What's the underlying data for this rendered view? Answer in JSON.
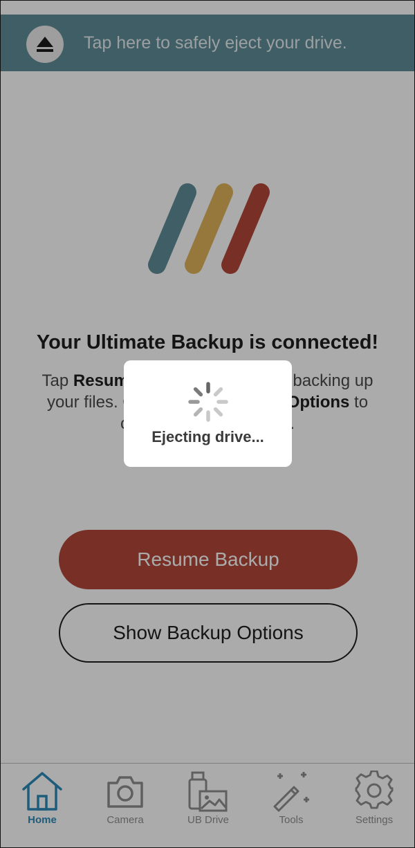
{
  "eject_banner": {
    "text": "Tap here to safely eject your drive.",
    "icon": "eject-icon"
  },
  "main": {
    "logo": "ultimate-backup-logo",
    "headline": "Your Ultimate Backup is connected!",
    "description": {
      "part1": "Tap ",
      "bold1": "Resume Backup",
      "part2": " to continue backing up your files. Or tap ",
      "bold2": "Show Backup Options",
      "part3": " to customize your backup."
    },
    "resume_button": "Resume Backup",
    "options_button": "Show Backup Options"
  },
  "modal": {
    "text": "Ejecting drive...",
    "icon": "spinner-icon"
  },
  "tabbar": {
    "tabs": [
      {
        "label": "Home",
        "icon": "home-icon",
        "active": true
      },
      {
        "label": "Camera",
        "icon": "camera-icon",
        "active": false
      },
      {
        "label": "UB Drive",
        "icon": "ub-drive-icon",
        "active": false
      },
      {
        "label": "Tools",
        "icon": "tools-icon",
        "active": false
      },
      {
        "label": "Settings",
        "icon": "settings-icon",
        "active": false
      }
    ]
  },
  "colors": {
    "banner": "#5e8c97",
    "accent_red": "#b3483a",
    "logo_teal": "#5e8c97",
    "logo_gold": "#e0b45c",
    "logo_red": "#b3483a",
    "active_tab": "#2c89b8"
  }
}
